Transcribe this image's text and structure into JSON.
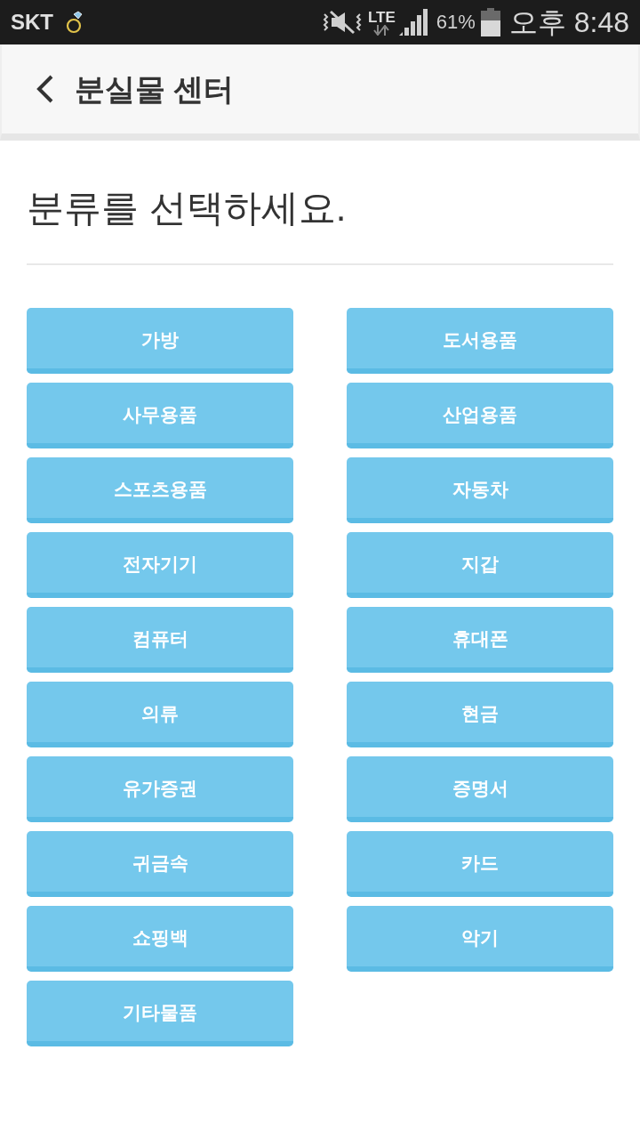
{
  "status_bar": {
    "carrier": "SKT",
    "network": "LTE",
    "battery": "61%",
    "time": "오후 8:48"
  },
  "header": {
    "title": "분실물 센터"
  },
  "prompt": "분류를 선택하세요.",
  "categories": [
    "가방",
    "도서용품",
    "사무용품",
    "산업용품",
    "스포츠용품",
    "자동차",
    "전자기기",
    "지갑",
    "컴퓨터",
    "휴대폰",
    "의류",
    "현금",
    "유가증권",
    "증명서",
    "귀금속",
    "카드",
    "쇼핑백",
    "악기",
    "기타물품"
  ]
}
